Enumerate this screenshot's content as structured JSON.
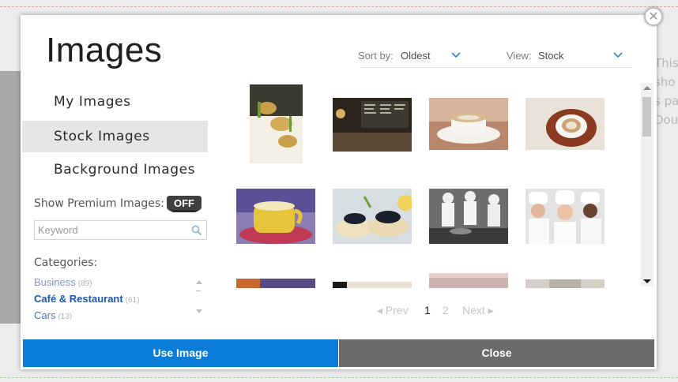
{
  "background": {
    "side_text_lines": [
      "This",
      "sho",
      "s pa",
      "Dou"
    ]
  },
  "modal": {
    "title": "Images",
    "close_symbol": "✕",
    "sort": {
      "label": "Sort by:",
      "value": "Oldest"
    },
    "view": {
      "label": "View:",
      "value": "Stock"
    },
    "sidebar": {
      "items": [
        {
          "label": "My Images",
          "active": false
        },
        {
          "label": "Stock Images",
          "active": true
        },
        {
          "label": "Background Images",
          "active": false
        }
      ],
      "premium_label": "Show Premium Images:",
      "premium_toggle": "OFF",
      "search_placeholder": "Keyword",
      "categories_heading": "Categories:",
      "categories": [
        {
          "name": "Business",
          "count": "(89)"
        },
        {
          "name": "Café & Restaurant",
          "count": "(61)"
        },
        {
          "name": "Cars",
          "count": "(13)"
        }
      ]
    },
    "images": [
      "appetizer-rolls-plate",
      "cafe-bar-interior",
      "cappuccino-cup-saucer",
      "coffee-cup-top-view",
      "yellow-tea-cup",
      "caviar-tartlets",
      "kitchen-chefs-cooking",
      "smiling-chefs-group",
      "partial-image-9",
      "partial-image-10",
      "partial-image-11",
      "partial-image-12"
    ],
    "pagination": {
      "prev": "◂ Prev",
      "current": "1",
      "next_page": "2",
      "next": "Next ▸"
    },
    "buttons": {
      "use": "Use Image",
      "close": "Close"
    },
    "colors": {
      "primary": "#0b7cd8",
      "secondary": "#6b6b6b",
      "active_nav": "#e6e6e6"
    }
  }
}
